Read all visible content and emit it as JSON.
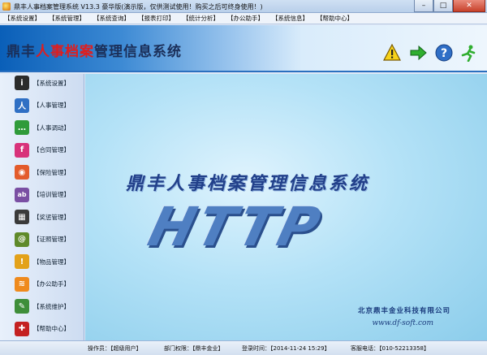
{
  "window": {
    "title": "鼎丰人事档案管理系统 V13.3 豪华版(演示版，仅供测试使用！购买之后可终身使用！)",
    "buttons": {
      "minimize": "–",
      "maximize": "□",
      "close": "✕"
    }
  },
  "menu": [
    "【系统设置】",
    "【系统管理】",
    "【系统查询】",
    "【报表打印】",
    "【统计分析】",
    "【办公助手】",
    "【系统信息】",
    "【帮助中心】"
  ],
  "header": {
    "title_part1": "鼎丰",
    "title_part2": "人事档案",
    "title_part3": "管理信息系统",
    "icons": [
      "warning-icon",
      "arrow-right-icon",
      "help-icon",
      "runner-exit-icon"
    ]
  },
  "sidebar": {
    "items": [
      {
        "label": "【系统设置】",
        "icon": "info-icon",
        "color": "#2b2b2b",
        "glyph": "i"
      },
      {
        "label": "【人事管理】",
        "icon": "people-icon",
        "color": "#2f6fc4",
        "glyph": "人"
      },
      {
        "label": "【人事调动】",
        "icon": "chat-icon",
        "color": "#2f9b3a",
        "glyph": "…"
      },
      {
        "label": "【合同管理】",
        "icon": "f-icon",
        "color": "#d8327a",
        "glyph": "f"
      },
      {
        "label": "【保险管理】",
        "icon": "ring-icon",
        "color": "#e35b2b",
        "glyph": "◉"
      },
      {
        "label": "【培训管理】",
        "icon": "ab-icon",
        "color": "#7a4fa3",
        "glyph": "ab"
      },
      {
        "label": "【奖惩管理】",
        "icon": "grid-icon",
        "color": "#3a3a3a",
        "glyph": "▦"
      },
      {
        "label": "【证照管理】",
        "icon": "at-icon",
        "color": "#5f8a2a",
        "glyph": "@"
      },
      {
        "label": "【物品管理】",
        "icon": "lightbulb-icon",
        "color": "#e3a21a",
        "glyph": "!"
      },
      {
        "label": "【办公助手】",
        "icon": "rss-icon",
        "color": "#ef8a1d",
        "glyph": "≋"
      },
      {
        "label": "【系统维护】",
        "icon": "pen-icon",
        "color": "#3e8e3a",
        "glyph": "✎"
      },
      {
        "label": "【帮助中心】",
        "icon": "gift-icon",
        "color": "#c42121",
        "glyph": "✚"
      }
    ]
  },
  "main": {
    "title": "鼎丰人事档案管理信息系统",
    "logo": "HTTP",
    "company": "北京鼎丰金业科技有限公司",
    "website": "www.df-soft.com"
  },
  "status": {
    "operator_label": "操作员：",
    "operator": "【超级用户】",
    "dept_label": "部门权限：",
    "dept": "【鼎丰金业】",
    "login_label": "登录时间：",
    "login": "【2014-11-24 15:29】",
    "phone_label": "客服电话：",
    "phone": "【010-52213358】"
  }
}
